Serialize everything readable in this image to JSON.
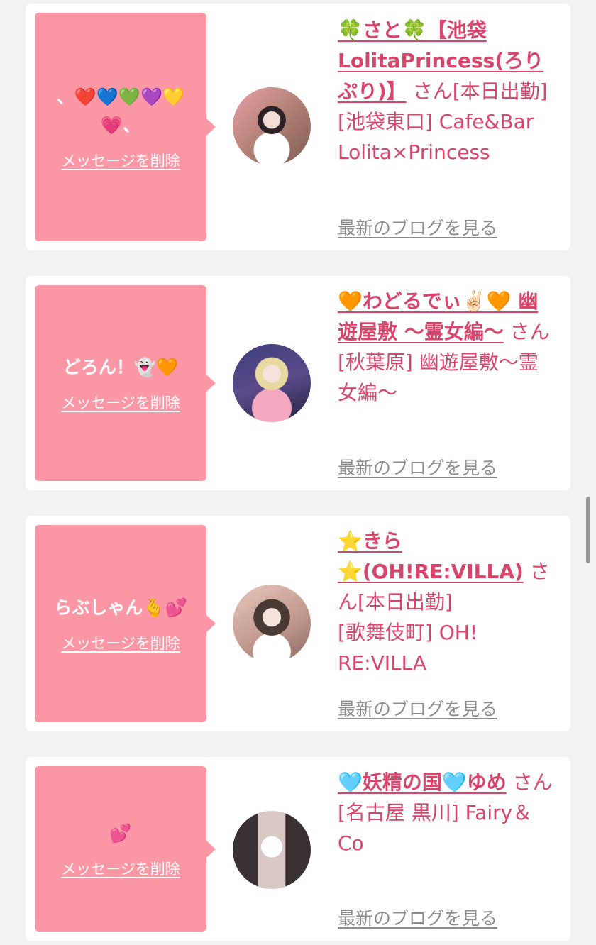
{
  "cards": [
    {
      "message": "、❤️💙💚💜💛💗、",
      "delete_label": "メッセージを削除",
      "name": "🍀さと🍀【池袋LolitaPrincess(ろりぷり)】",
      "san_status": "さん[本日出勤]",
      "location": "[池袋東口] Cafe&Bar Lolita×Princess",
      "blog_label": "最新のブログを見る"
    },
    {
      "message": "どろん！👻🧡",
      "delete_label": "メッセージを削除",
      "name": "🧡わどるでぃ✌🏻🧡 幽遊屋敷 〜霊女編〜",
      "san_status": "さん",
      "location": "[秋葉原] 幽遊屋敷〜霊女編〜",
      "blog_label": "最新のブログを見る"
    },
    {
      "message": "らぶしゃん🫰💕",
      "delete_label": "メッセージを削除",
      "name": "⭐きら⭐(OH!RE:VILLA)",
      "san_status": "さん[本日出勤]",
      "location": "[歌舞伎町] OH! RE:VILLA",
      "blog_label": "最新のブログを見る"
    },
    {
      "message": "💕",
      "delete_label": "メッセージを削除",
      "name": "🩵妖精の国🩵ゆめ",
      "san_status": "さん",
      "location": "[名古屋 黒川] Fairy＆Co",
      "blog_label": "最新のブログを見る"
    }
  ],
  "colors": {
    "bubble": "#fc97a6",
    "link": "#d8456a",
    "blog_link": "#8c8c8c",
    "background": "#f2f2f2"
  }
}
